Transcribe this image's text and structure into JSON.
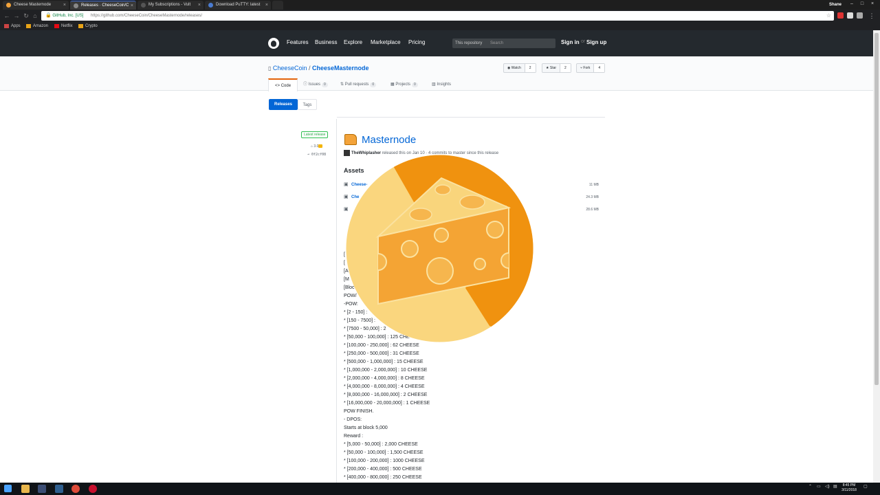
{
  "browser": {
    "tabs": [
      {
        "title": "Cheese Masternode",
        "active": false,
        "favicon_color": "#f3a33a"
      },
      {
        "title": "Releases · CheeseCoin/C",
        "active": true,
        "favicon_color": "#24292e"
      },
      {
        "title": "My Subscriptions - Vult",
        "active": false,
        "favicon_color": "#555"
      },
      {
        "title": "Download PuTTY: latest",
        "active": false,
        "favicon_color": "#4a7bd0"
      }
    ],
    "user": "Shane",
    "secure_label": "GitHub, Inc. [US]",
    "url": "https://github.com/CheeseCoin/CheeseMasternode/releases/",
    "bookmarks": [
      "Apps",
      "Amazon",
      "Netflix",
      "Crypto"
    ]
  },
  "github": {
    "nav": [
      "Features",
      "Business",
      "Explore",
      "Marketplace",
      "Pricing"
    ],
    "search_scope": "This repository",
    "search_placeholder": "Search",
    "sign_in": "Sign in",
    "or": "or",
    "sign_up": "Sign up"
  },
  "repo": {
    "owner": "CheeseCoin",
    "separator": "/",
    "name": "CheeseMasternode",
    "watch": {
      "label": "Watch",
      "count": "2"
    },
    "star": {
      "label": "Star",
      "count": "2"
    },
    "fork": {
      "label": "Fork",
      "count": "4"
    },
    "tabs": [
      {
        "label": "Code",
        "count": ""
      },
      {
        "label": "Issues",
        "count": "0"
      },
      {
        "label": "Pull requests",
        "count": "0"
      },
      {
        "label": "Projects",
        "count": "0"
      },
      {
        "label": "Insights",
        "count": ""
      }
    ]
  },
  "subnav": {
    "releases": "Releases",
    "tags": "Tags"
  },
  "release": {
    "latest_badge": "Latest release",
    "tag": "3.0",
    "commit": "0f2cf08",
    "title": "Masternode",
    "author": "TheWhiplasher",
    "byline": "released this on Jan 10 · 4 commits to master since this release",
    "assets_heading": "Assets",
    "assets": [
      {
        "name": "Cheese-",
        "size": "11 MB"
      },
      {
        "name": "Che",
        "size": "24.3 MB"
      },
      {
        "name": "",
        "size": "28.6 MB"
      }
    ],
    "notes": [
      "[",
      "[",
      "[A",
      "[M",
      "[Bloc",
      "POW/",
      "-POW:",
      "* [2 - 150] :",
      "* [150 - 7500] :",
      "* [7500 - 50,000] : 2",
      "* [50,000 - 100,000] : 125 CHE",
      "* [100,000 - 250,000] : 62 CHEESE",
      "* [250,000 - 500,000] : 31 CHEESE",
      "* [500,000 - 1,000,000] : 15 CHEESE",
      "* [1,000,000 - 2,000,000] : 10 CHEESE",
      "* [2,000,000 - 4,000,000] : 8 CHEESE",
      "* [4,000,000 - 8,000,000] : 4 CHEESE",
      "* [8,000,000 - 16,000,000] : 2 CHEESE",
      "* [16,000,000 - 20,000,000] : 1 CHEESE",
      "POW FINISH.",
      "- DPOS:",
      "Starts at block 5,000",
      "Reward :",
      "* [5,000 - 50,000] : 2,000 CHEESE",
      "* [50,000 - 100,000] : 1,500 CHEESE",
      "* [100,000 - 200,000] : 1000 CHEESE",
      "* [200,000 - 400,000] : 500 CHEESE",
      "* [400,000 - 800,000] : 250 CHEESE"
    ]
  },
  "taskbar": {
    "time": "8:45 PM",
    "date": "3/11/2018"
  },
  "colors": {
    "github_header": "#24292e",
    "link_blue": "#0366d6",
    "cheese_orange": "#f0920f",
    "cheese_light": "#fad67e"
  }
}
